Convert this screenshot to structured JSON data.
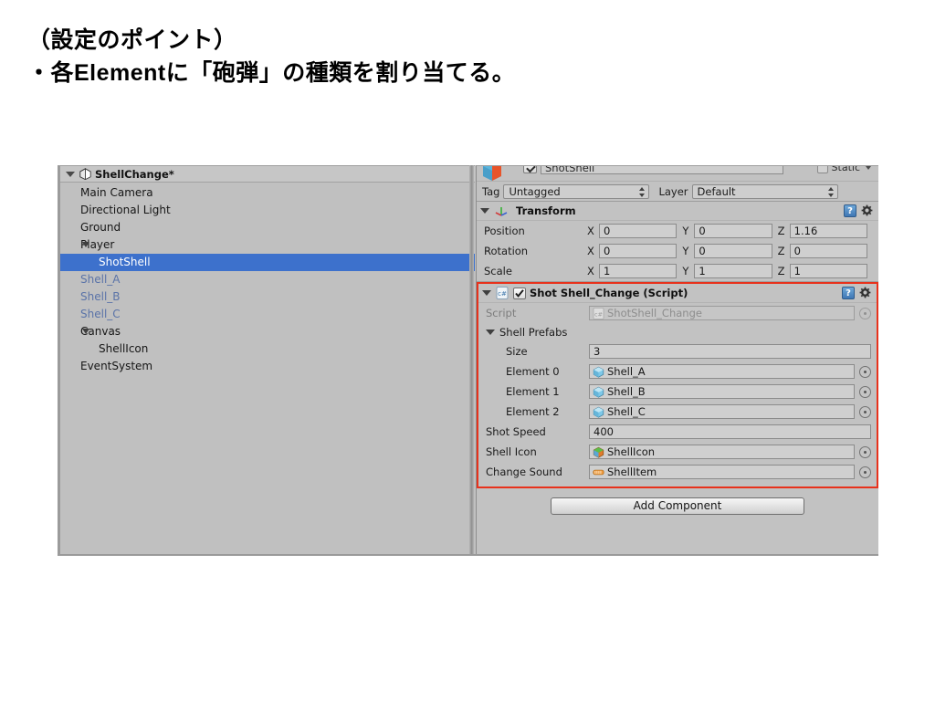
{
  "slide": {
    "lines": [
      "（設定のポイント）",
      "・各Elementに「砲弾」の種類を割り当てる。"
    ]
  },
  "hierarchy": {
    "title": "ShellChange*",
    "menu_icon": "hamburger-menu-icon",
    "items": [
      {
        "label": "Main Camera",
        "indent": 1,
        "expandable": false,
        "selected": false,
        "prefab": false
      },
      {
        "label": "Directional Light",
        "indent": 1,
        "expandable": false,
        "selected": false,
        "prefab": false
      },
      {
        "label": "Ground",
        "indent": 1,
        "expandable": false,
        "selected": false,
        "prefab": false
      },
      {
        "label": "Player",
        "indent": 1,
        "expandable": true,
        "selected": false,
        "prefab": false
      },
      {
        "label": "ShotShell",
        "indent": 2,
        "expandable": false,
        "selected": true,
        "prefab": false
      },
      {
        "label": "Shell_A",
        "indent": 1,
        "expandable": false,
        "selected": false,
        "prefab": true
      },
      {
        "label": "Shell_B",
        "indent": 1,
        "expandable": false,
        "selected": false,
        "prefab": true
      },
      {
        "label": "Shell_C",
        "indent": 1,
        "expandable": false,
        "selected": false,
        "prefab": true
      },
      {
        "label": "Canvas",
        "indent": 1,
        "expandable": true,
        "selected": false,
        "prefab": false
      },
      {
        "label": "ShellIcon",
        "indent": 2,
        "expandable": false,
        "selected": false,
        "prefab": false
      },
      {
        "label": "EventSystem",
        "indent": 1,
        "expandable": false,
        "selected": false,
        "prefab": false
      }
    ]
  },
  "inspector": {
    "gameobject": {
      "name": "ShotShell",
      "enabled": true,
      "static_label": "Static"
    },
    "tag": {
      "label": "Tag",
      "value": "Untagged"
    },
    "layer": {
      "label": "Layer",
      "value": "Default"
    },
    "transform": {
      "title": "Transform",
      "rows": [
        {
          "label": "Position",
          "x": "0",
          "y": "0",
          "z": "1.16"
        },
        {
          "label": "Rotation",
          "x": "0",
          "y": "0",
          "z": "0"
        },
        {
          "label": "Scale",
          "x": "1",
          "y": "1",
          "z": "1"
        }
      ],
      "axis_labels": [
        "X",
        "Y",
        "Z"
      ]
    },
    "script_component": {
      "title": "Shot Shell_Change (Script)",
      "enabled": true,
      "highlight_color": "#e8321c",
      "script_row": {
        "label": "Script",
        "value": "ShotShell_Change"
      },
      "array": {
        "label": "Shell Prefabs",
        "size_label": "Size",
        "size_value": "3",
        "elements": [
          {
            "label": "Element 0",
            "value": "Shell_A",
            "icon": "prefab-cube-icon"
          },
          {
            "label": "Element 1",
            "value": "Shell_B",
            "icon": "prefab-cube-icon"
          },
          {
            "label": "Element 2",
            "value": "Shell_C",
            "icon": "prefab-cube-icon"
          }
        ]
      },
      "fields": [
        {
          "label": "Shot Speed",
          "value": "400",
          "type": "number"
        },
        {
          "label": "Shell Icon",
          "value": "ShellIcon",
          "type": "object",
          "icon": "prefab-variant-cube-icon"
        },
        {
          "label": "Change Sound",
          "value": "ShellItem",
          "type": "object",
          "icon": "audio-clip-icon"
        }
      ]
    },
    "add_component_label": "Add Component"
  },
  "colors": {
    "selection_blue": "#3d71cc",
    "prefab_blue": "#5a73a8",
    "panel_gray": "#c2c2c2",
    "highlight_red": "#e8321c"
  }
}
